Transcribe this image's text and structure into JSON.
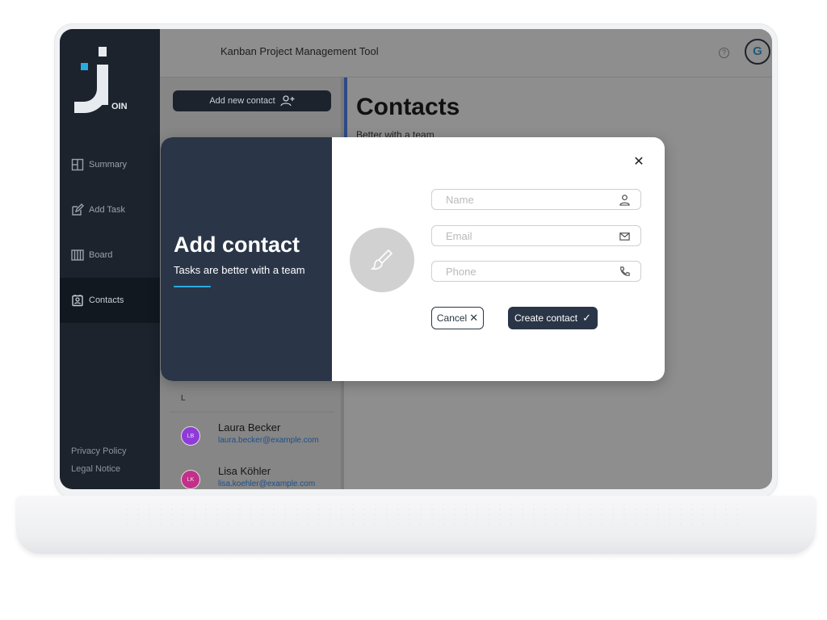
{
  "app": {
    "title": "Kanban Project Management Tool",
    "logo_text": "OIN",
    "user_initial": "G"
  },
  "sidebar": {
    "items": [
      {
        "label": "Summary",
        "icon": "summary-icon"
      },
      {
        "label": "Add Task",
        "icon": "edit-icon"
      },
      {
        "label": "Board",
        "icon": "board-icon"
      },
      {
        "label": "Contacts",
        "icon": "contacts-icon",
        "active": true
      }
    ],
    "privacy_policy": "Privacy Policy",
    "legal_notice": "Legal Notice"
  },
  "contacts_list": {
    "add_button_label": "Add new contact",
    "group_letter": "L",
    "contacts": [
      {
        "initials": "LB",
        "name": "Laura Becker",
        "email": "laura.becker@example.com",
        "color": "#8e3bd9"
      },
      {
        "initials": "LK",
        "name": "Lisa Köhler",
        "email": "lisa.koehler@example.com",
        "color": "#c2308a"
      }
    ]
  },
  "main": {
    "title": "Contacts",
    "subtitle": "Better with a team"
  },
  "modal": {
    "title": "Add contact",
    "subtitle": "Tasks are better with a team",
    "fields": {
      "name_placeholder": "Name",
      "email_placeholder": "Email",
      "phone_placeholder": "Phone"
    },
    "cancel_label": "Cancel",
    "create_label": "Create contact"
  },
  "colors": {
    "sidebar_bg": "#1c232d",
    "modal_left_bg": "#2a3647",
    "accent": "#29abe2",
    "overlay_gray": "#8e8e8e"
  }
}
